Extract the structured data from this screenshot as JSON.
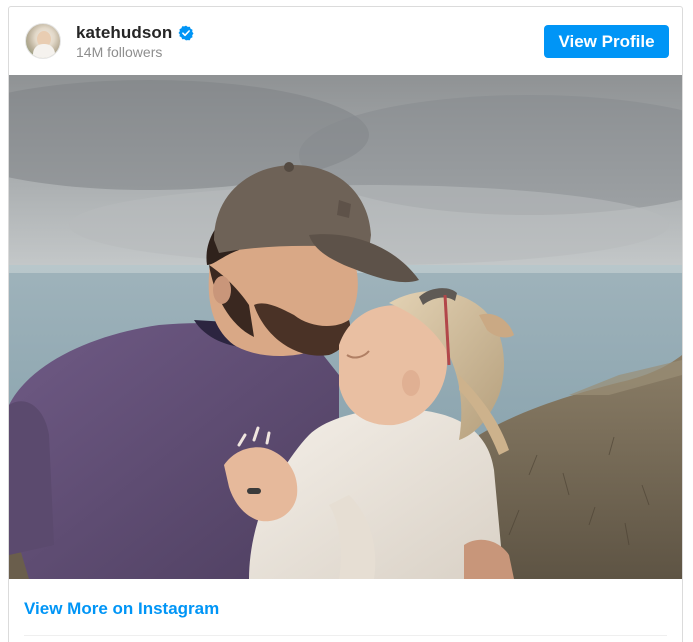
{
  "post": {
    "username": "katehudson",
    "followers": "14M followers",
    "verified": true,
    "view_profile_label": "View Profile",
    "view_more_label": "View More on Instagram"
  },
  "icons": {
    "verified": "verified-badge-icon",
    "avatar": "profile-avatar"
  },
  "colors": {
    "accent": "#0095f6",
    "text_primary": "#262626",
    "text_secondary": "#8e8e8e",
    "border": "#dbdbdb"
  }
}
